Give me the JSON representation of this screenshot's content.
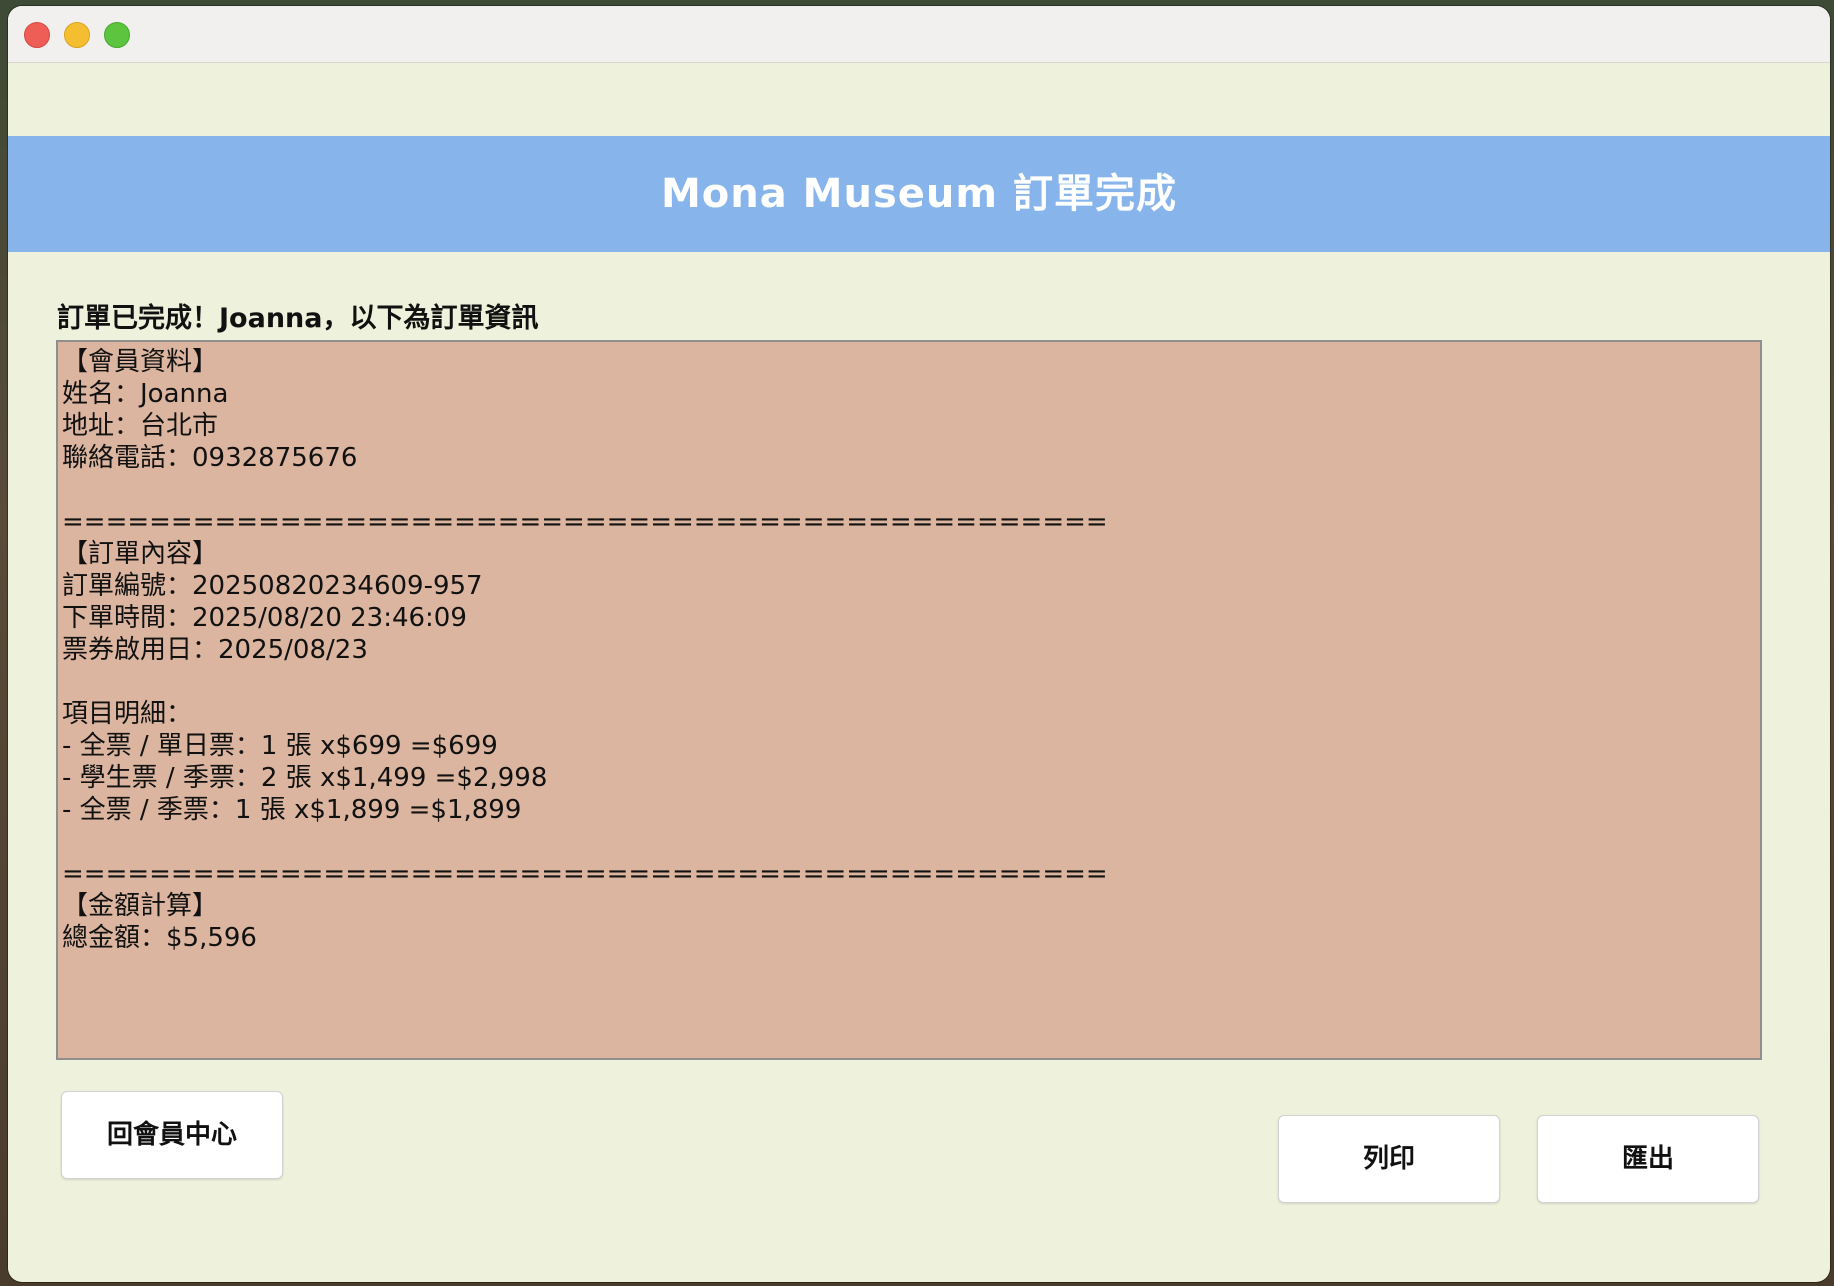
{
  "window": {
    "controls": [
      "close",
      "minimize",
      "zoom"
    ]
  },
  "header": {
    "title": "Mona Museum 訂單完成"
  },
  "subtitle": "訂單已完成！Joanna，以下為訂單資訊",
  "details": {
    "lines": [
      "【會員資料】",
      "姓名：Joanna",
      "地址：台北市",
      "聯絡電話：0932875676",
      "",
      "================================================",
      "【訂單內容】",
      "訂單編號：20250820234609-957",
      "下單時間：2025/08/20 23:46:09",
      "票券啟用日：2025/08/23",
      "",
      "項目明細：",
      "- 全票 / 單日票：1 張 x$699 =$699",
      "- 學生票 / 季票：2 張 x$1,499 =$2,998",
      "- 全票 / 季票：1 張 x$1,899 =$1,899",
      "",
      "================================================",
      "【金額計算】",
      "總金額：$5,596"
    ]
  },
  "buttons": {
    "back": "回會員中心",
    "print": "列印",
    "export": "匯出"
  },
  "colors": {
    "window_bg": "#eef2dc",
    "header_bg": "#87b4eb",
    "details_bg": "#dcb5a0"
  }
}
